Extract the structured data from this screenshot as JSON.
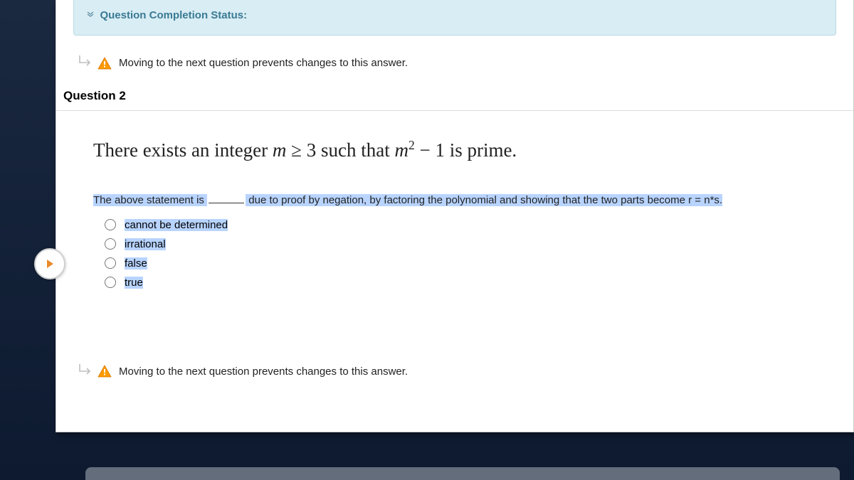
{
  "status": {
    "label": "Question Completion Status:"
  },
  "warning": {
    "text": "Moving to the next question prevents changes to this answer."
  },
  "question": {
    "header": "Question 2",
    "stmt_pre": "There exists an integer ",
    "stmt_m": "m",
    "stmt_geq": " ≥ 3 such that ",
    "stmt_m2": "m",
    "stmt_sq": "2",
    "stmt_post": " − 1 is prime.",
    "prompt_a": "The above statement is ",
    "prompt_b": " due to proof by negation, by factoring the polynomial and showing that the two parts become r = n*s. ",
    "options": [
      "cannot be determined",
      "irrational",
      "false",
      "true"
    ]
  }
}
